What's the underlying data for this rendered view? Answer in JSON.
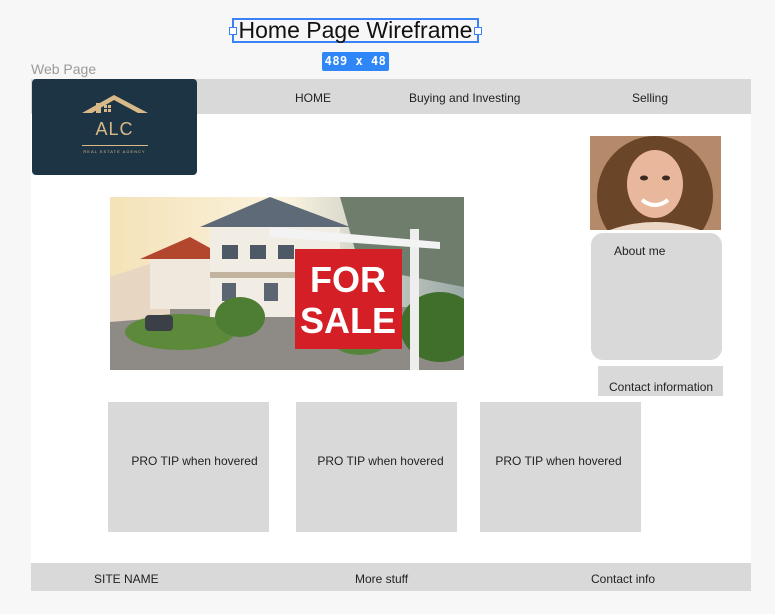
{
  "canvas": {
    "title": "Home Page Wireframe",
    "dimensions_badge": "489  x  48",
    "frame_label": "Web Page"
  },
  "logo": {
    "text": "ALC",
    "subtext": "REAL ESTATE AGENCY"
  },
  "nav": {
    "items": [
      "HOME",
      "Buying and Investing",
      "Selling"
    ]
  },
  "hero_sign": {
    "line1": "FOR",
    "line2": "SALE"
  },
  "sidebar": {
    "about_label": "About me",
    "contact_label": "Contact information"
  },
  "tips": [
    {
      "label": "PRO TIP when hovered"
    },
    {
      "label": "PRO TIP when hovered"
    },
    {
      "label": "PRO TIP when hovered"
    }
  ],
  "footer": {
    "site_name": "SITE NAME",
    "more": "More stuff",
    "contact": "Contact info"
  },
  "colors": {
    "accent": "#2f86f6",
    "placeholder_gray": "#d9d9d9",
    "logo_bg": "#1d3444",
    "logo_gold": "#d9b98a",
    "sign_red": "#d51f26"
  }
}
